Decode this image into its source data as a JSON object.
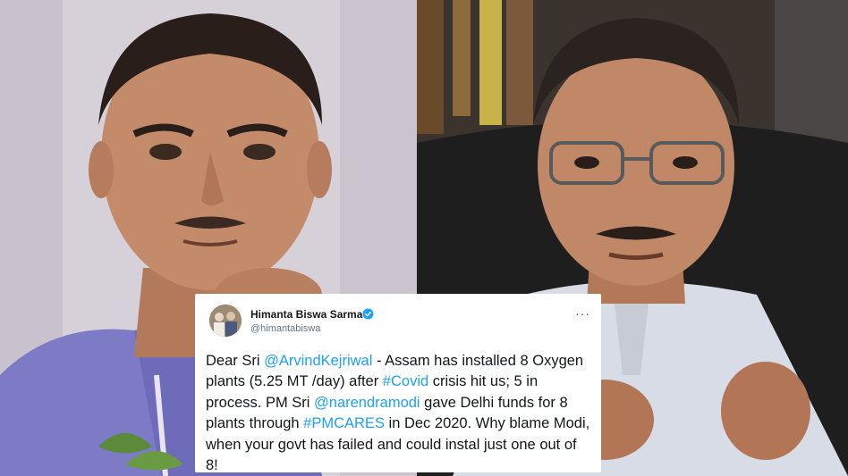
{
  "tweet": {
    "name": "Himanta Biswa Sarma",
    "handle": "@himantabiswa",
    "more": "···",
    "text_parts": {
      "p1": "Dear Sri ",
      "m1": "@ArvindKejriwal",
      "p2": " - Assam has installed 8 Oxygen plants (5.25 MT /day) after ",
      "h1": "#Covid",
      "p3": " crisis hit us; 5 in process. PM Sri ",
      "m2": "@narendramodi",
      "p4": " gave Delhi funds for 8 plants through ",
      "h2": "#PMCARES",
      "p5": " in Dec 2020. Why blame Modi, when your govt has failed and could instal just one out of 8!"
    }
  },
  "colors": {
    "link": "#1da1f2",
    "verified": "#1da1f2",
    "text": "#14171a",
    "handle": "#657786"
  },
  "icons": [
    "verified-badge-icon",
    "more-options-icon"
  ]
}
